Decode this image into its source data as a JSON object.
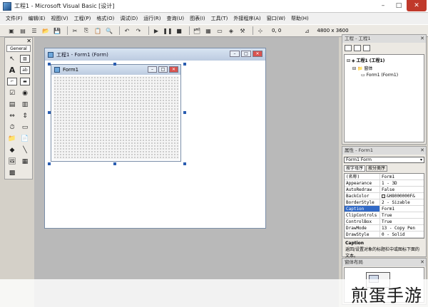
{
  "window": {
    "title": "工程1 - Microsoft Visual Basic [设计]",
    "minimize_glyph": "–",
    "maximize_glyph": "□",
    "close_glyph": "✕"
  },
  "menu": [
    "文件(F)",
    "编辑(E)",
    "视图(V)",
    "工程(P)",
    "格式(O)",
    "调试(D)",
    "运行(R)",
    "查询(U)",
    "图表(I)",
    "工具(T)",
    "外接程序(A)",
    "窗口(W)",
    "帮助(H)"
  ],
  "toolbar": {
    "position": "0, 0",
    "size": "4800 x 3600"
  },
  "toolbox": {
    "tab": "General",
    "close": "✕"
  },
  "designer": {
    "title": "工程1 - Form1 (Form)",
    "form_caption": "Form1"
  },
  "project": {
    "title": "工程 - 工程1",
    "close": "✕",
    "tree": [
      "工程1 (工程1)",
      "窗体",
      "Form1 (Form1)"
    ]
  },
  "properties": {
    "title": "属性 - Form1",
    "close": "✕",
    "object": "Form1 Form",
    "tabs": [
      "按字母序",
      "按分类序"
    ],
    "rows": [
      {
        "name": "(名称)",
        "value": "Form1"
      },
      {
        "name": "Appearance",
        "value": "1 - 3D"
      },
      {
        "name": "AutoRedraw",
        "value": "False"
      },
      {
        "name": "BackColor",
        "value": "&H8000000F&"
      },
      {
        "name": "BorderStyle",
        "value": "2 - Sizable"
      },
      {
        "name": "Caption",
        "value": "Form1"
      },
      {
        "name": "ClipControls",
        "value": "True"
      },
      {
        "name": "ControlBox",
        "value": "True"
      },
      {
        "name": "DrawMode",
        "value": "13 - Copy Pen"
      },
      {
        "name": "DrawStyle",
        "value": "0 - Solid"
      }
    ],
    "desc_title": "Caption",
    "desc_text": "返回/设置对象的标题栏中或图标下面的文本。"
  },
  "layout_pane": {
    "title": "窗体布局",
    "close": "✕"
  },
  "watermark": "煎蛋手游"
}
